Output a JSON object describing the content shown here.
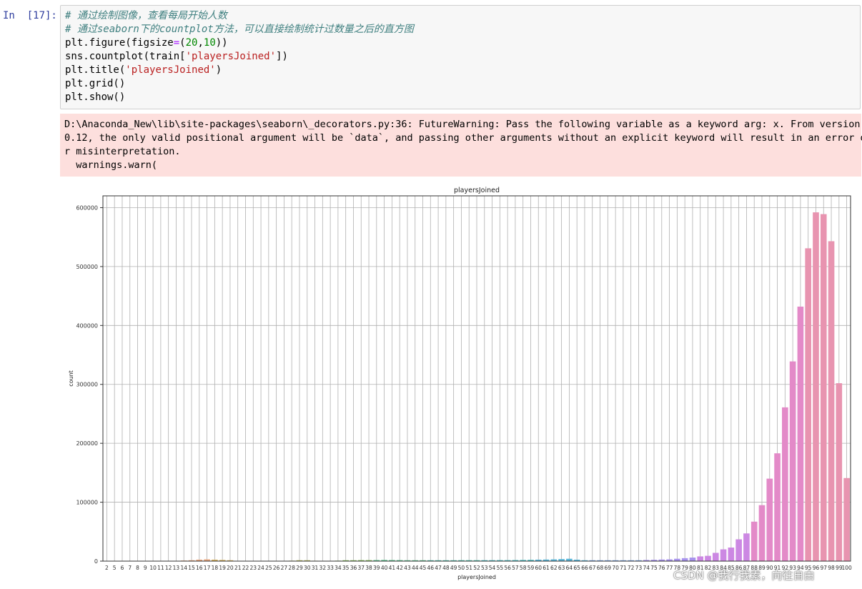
{
  "prompt": "In  [17]:",
  "code": {
    "comment1": "# 通过绘制图像，查看每局开始人数",
    "comment2": "# 通过seaborn下的countplot方法，可以直接绘制统计过数量之后的直方图",
    "l3_a": "plt.figure(figsize",
    "l3_eq": "=",
    "l3_b": "(",
    "l3_n1": "20",
    "l3_c": ",",
    "l3_n2": "10",
    "l3_d": "))",
    "l4_a": "sns.countplot(train[",
    "l4_s": "'playersJoined'",
    "l4_b": "])",
    "l5_a": "plt.title(",
    "l5_s": "'playersJoined'",
    "l5_b": ")",
    "l6": "plt.grid()",
    "l7": "plt.show()"
  },
  "stderr": {
    "line1": "D:\\Anaconda_New\\lib\\site-packages\\seaborn\\_decorators.py:36: FutureWarning: Pass the following variable as a keyword arg: x. From version",
    "line2": "0.12, the only valid positional argument will be `data`, and passing other arguments without an explicit keyword will result in an error o",
    "line3": "r misinterpretation.",
    "line4": "  warnings.warn("
  },
  "watermark": "CSDN @我行我素，向往自由",
  "chart_data": {
    "type": "bar",
    "title": "playersJoined",
    "xlabel": "playersJoined",
    "ylabel": "count",
    "ylim": [
      0,
      620000
    ],
    "yticks": [
      0,
      100000,
      200000,
      300000,
      400000,
      500000,
      600000
    ],
    "grid": true,
    "categories": [
      "2",
      "5",
      "6",
      "7",
      "8",
      "9",
      "10",
      "11",
      "12",
      "13",
      "14",
      "15",
      "16",
      "17",
      "18",
      "19",
      "20",
      "21",
      "22",
      "23",
      "24",
      "25",
      "26",
      "27",
      "28",
      "29",
      "30",
      "31",
      "32",
      "33",
      "34",
      "35",
      "36",
      "37",
      "38",
      "39",
      "40",
      "41",
      "42",
      "43",
      "44",
      "45",
      "46",
      "47",
      "48",
      "49",
      "50",
      "51",
      "52",
      "53",
      "54",
      "55",
      "56",
      "57",
      "58",
      "59",
      "60",
      "61",
      "62",
      "63",
      "64",
      "65",
      "66",
      "67",
      "68",
      "69",
      "70",
      "71",
      "72",
      "73",
      "74",
      "75",
      "76",
      "77",
      "78",
      "79",
      "80",
      "81",
      "82",
      "83",
      "84",
      "85",
      "86",
      "87",
      "88",
      "89",
      "90",
      "91",
      "92",
      "93",
      "94",
      "95",
      "96",
      "97",
      "98",
      "99",
      "100"
    ],
    "values": [
      200,
      100,
      100,
      100,
      100,
      100,
      100,
      100,
      100,
      200,
      1000,
      1500,
      2500,
      3000,
      2500,
      2000,
      1500,
      500,
      300,
      300,
      300,
      300,
      300,
      500,
      800,
      1500,
      1500,
      700,
      500,
      500,
      800,
      1500,
      1500,
      1700,
      1700,
      1800,
      2000,
      1800,
      1700,
      1500,
      1500,
      1500,
      1500,
      1500,
      1500,
      1500,
      1600,
      1600,
      1600,
      1600,
      1600,
      1700,
      1700,
      1800,
      2000,
      2200,
      2500,
      2700,
      3000,
      3500,
      4000,
      2500,
      1500,
      1500,
      1500,
      1500,
      1500,
      1500,
      1500,
      1500,
      2000,
      2300,
      2700,
      3000,
      4000,
      5000,
      6000,
      8000,
      9000,
      14000,
      20000,
      23000,
      37000,
      47000,
      67000,
      95000,
      140000,
      183000,
      261000,
      339000,
      432000,
      531000,
      592000,
      589000,
      543000,
      302000,
      141000
    ],
    "colors": [
      "#e8a2a3",
      "#e8a57c",
      "#d6b05e",
      "#b4b95a",
      "#88c05b",
      "#5ec38f",
      "#52c2ae",
      "#4fbfc4",
      "#58b6d8",
      "#7aa6e6",
      "#a893ee",
      "#cc88e3",
      "#e38ac8",
      "#e894b0"
    ]
  }
}
